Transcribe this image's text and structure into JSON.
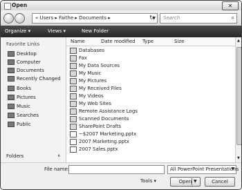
{
  "window": {
    "title": "Open",
    "close_glyph": "✕"
  },
  "nav": {
    "back_icon": "back-arrow-icon",
    "forward_icon": "forward-arrow-icon",
    "address": "« Users ▸ Faithe ▸ Documents ▸",
    "refresh_glyph": "↻",
    "search_placeholder": "Search"
  },
  "toolbar": {
    "organize": "Organize ▾",
    "views": "Views ▾",
    "new_folder": "New Folder"
  },
  "sidebar": {
    "header": "Favorite Links",
    "items": [
      "Desktop",
      "Computer",
      "Documents",
      "Recently Changed",
      "Books",
      "Pictures",
      "Music",
      "Searches",
      "Public"
    ],
    "folders_label": "Folders",
    "folders_chevron": "∧"
  },
  "columns": [
    "Name",
    "Date modified",
    "Type",
    "Size"
  ],
  "files": [
    {
      "name": "Databases",
      "icon": "folder-icon"
    },
    {
      "name": "Fax",
      "icon": "folder-icon"
    },
    {
      "name": "My Data Sources",
      "icon": "folder-icon"
    },
    {
      "name": "My Music",
      "icon": "music-folder-icon"
    },
    {
      "name": "My Pictures",
      "icon": "picture-folder-icon"
    },
    {
      "name": "My Received Files",
      "icon": "folder-icon"
    },
    {
      "name": "My Videos",
      "icon": "video-folder-icon"
    },
    {
      "name": "My Web Sites",
      "icon": "web-folder-icon"
    },
    {
      "name": "Remote Assistance Logs",
      "icon": "folder-icon"
    },
    {
      "name": "Scanned Documents",
      "icon": "folder-icon"
    },
    {
      "name": "SharePoint Drafts",
      "icon": "sharepoint-folder-icon"
    },
    {
      "name": "~$2007 Marketing.pptx",
      "icon": "pptx-file-icon"
    },
    {
      "name": "2007 Marketing.pptx",
      "icon": "pptx-file-icon"
    },
    {
      "name": "2007 Sales.pptx",
      "icon": "pptx-file-icon"
    }
  ],
  "bottom": {
    "filename_label": "File name:",
    "filename_value": "",
    "filetype": "All PowerPoint Presentations",
    "tools": "Tools ▾",
    "open": "Open",
    "cancel": "Cancel"
  }
}
